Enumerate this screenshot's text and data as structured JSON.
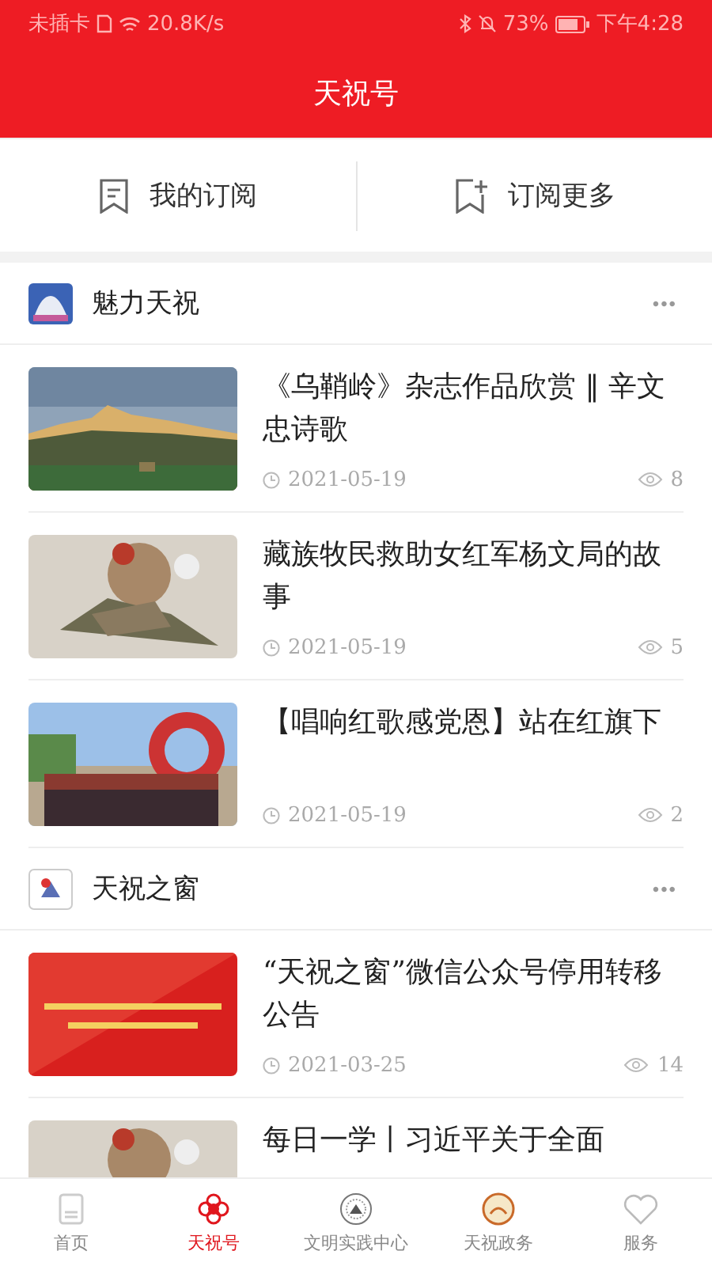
{
  "status_bar": {
    "carrier": "未插卡",
    "speed": "20.8K/s",
    "battery": "73%",
    "time": "下午4:28"
  },
  "header": {
    "title": "天祝号"
  },
  "subscription_bar": [
    {
      "kind": "list",
      "label": "我的订阅"
    },
    {
      "kind": "add",
      "label": "订阅更多"
    }
  ],
  "sections": [
    {
      "name": "魅力天祝",
      "more": "•••",
      "articles": [
        {
          "title": "《乌鞘岭》杂志作品欣赏 ‖ 辛文忠诗歌",
          "date": "2021-05-19",
          "views": "8"
        },
        {
          "title": "藏族牧民救助女红军杨文局的故事",
          "date": "2021-05-19",
          "views": "5"
        },
        {
          "title": "【唱响红歌感党恩】站在红旗下",
          "date": "2021-05-19",
          "views": "2"
        }
      ]
    },
    {
      "name": "天祝之窗",
      "more": "•••",
      "articles": [
        {
          "title": "“天祝之窗”微信公众号停用转移公告",
          "date": "2021-03-25",
          "views": "14"
        },
        {
          "title": "每日一学丨习近平关于全面"
        }
      ]
    }
  ],
  "tabs": [
    {
      "label": "首页",
      "selected": false
    },
    {
      "label": "天祝号",
      "selected": true
    },
    {
      "label": "文明实践中心",
      "selected": false
    },
    {
      "label": "天祝政务",
      "selected": false
    },
    {
      "label": "服务",
      "selected": false
    }
  ]
}
